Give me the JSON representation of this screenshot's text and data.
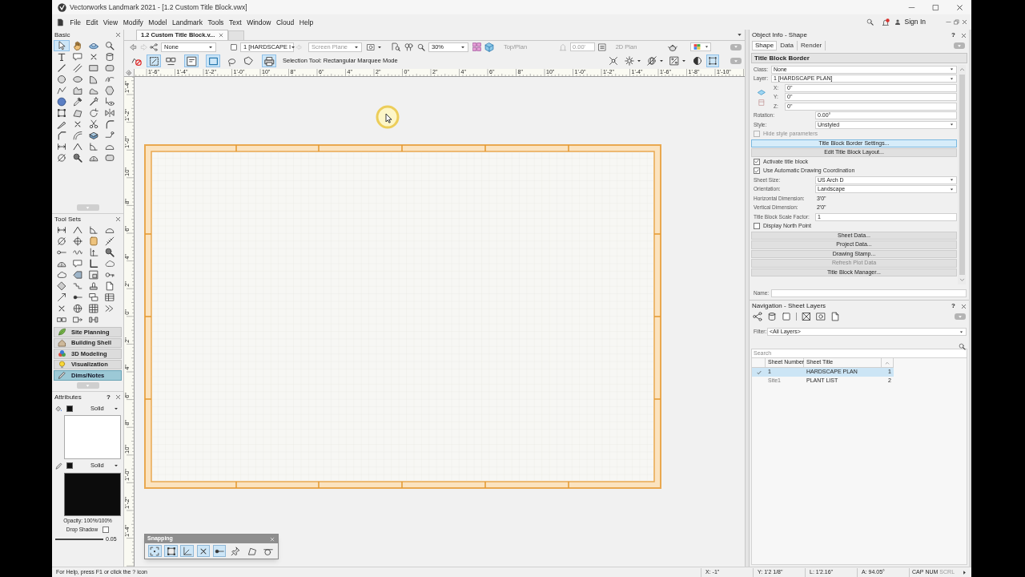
{
  "window": {
    "title": "Vectorworks Landmark 2021 - [1.2 Custom Title Block.vwx]"
  },
  "menu_bar": {
    "items": [
      "File",
      "Edit",
      "View",
      "Modify",
      "Model",
      "Landmark",
      "Tools",
      "Text",
      "Window",
      "Cloud",
      "Help"
    ],
    "sign_in": "Sign In"
  },
  "basic_palette": {
    "title": "Basic",
    "tools": [
      {
        "selected": true
      },
      {
        "selected": false
      },
      {
        "selected": false
      },
      {
        "selected": false
      },
      {
        "selected": false
      },
      {
        "selected": false
      },
      {
        "selected": false
      },
      {
        "selected": false
      },
      {
        "selected": false
      },
      {
        "selected": false
      },
      {
        "selected": false
      },
      {
        "selected": false
      },
      {
        "selected": false
      },
      {
        "selected": false
      },
      {
        "selected": false
      },
      {
        "selected": false
      },
      {
        "selected": false
      },
      {
        "selected": false
      },
      {
        "selected": false
      },
      {
        "selected": false
      },
      {
        "selected": false
      },
      {
        "selected": false
      },
      {
        "selected": false
      },
      {
        "selected": false
      },
      {
        "selected": false
      },
      {
        "selected": false
      },
      {
        "selected": false
      },
      {
        "selected": false
      },
      {
        "selected": false
      },
      {
        "selected": false
      },
      {
        "selected": false
      },
      {
        "selected": false
      },
      {
        "selected": false
      },
      {
        "selected": false
      },
      {
        "selected": false
      },
      {
        "selected": false
      },
      {
        "selected": false
      },
      {
        "selected": false
      },
      {
        "selected": false
      },
      {
        "selected": false
      },
      {
        "selected": false
      },
      {
        "selected": false
      },
      {
        "selected": false
      },
      {
        "selected": false
      }
    ]
  },
  "tool_sets_palette": {
    "title": "Tool Sets",
    "tool_sets": [
      {
        "label": "Site Planning",
        "selected": false
      },
      {
        "label": "Building Shell",
        "selected": false
      },
      {
        "label": "3D Modeling",
        "selected": false
      },
      {
        "label": "Visualization",
        "selected": false
      },
      {
        "label": "Dims/Notes",
        "selected": true
      }
    ]
  },
  "attributes": {
    "title": "Attributes",
    "help": "?",
    "fill_style": "Solid",
    "pen_style": "Solid",
    "opacity": "Opacity: 100%/100%",
    "drop_shadow": {
      "label": "Drop Shadow",
      "checked": false
    },
    "line_thickness": "0.05"
  },
  "document_tabs": [
    {
      "label": "1.2 Custom Title Block.v...",
      "selected": true
    },
    {
      "selected": false
    }
  ],
  "view_bar": {
    "class": "None",
    "layer": "1 [HARDSCAPE I",
    "plane": {
      "value": "Screen Plane",
      "disabled": true
    },
    "zoom": "30%",
    "view": {
      "value": "Top/Plan",
      "disabled": true
    },
    "elevation": {
      "value": "0.00'",
      "disabled": true
    },
    "render_mode": {
      "value": "2D Plan",
      "disabled": true
    }
  },
  "mode_bar": {
    "modes": [
      {
        "selected": false
      },
      {
        "selected": true
      },
      {
        "selected": false
      },
      {
        "selected": true
      },
      {
        "selected": true
      },
      {
        "selected": false
      },
      {
        "selected": false
      },
      {
        "selected": true
      }
    ],
    "hint": "Selection Tool: Rectangular Marquee Mode",
    "options": [
      {
        "on": false
      },
      {
        "on": false
      },
      {
        "on": false
      },
      {
        "on": false
      },
      {
        "on": false
      },
      {
        "on": true
      }
    ]
  },
  "rulers": {
    "horizontal": [
      "1'-6\"",
      "1'-4\"",
      "1'-2\"",
      "1'-0\"",
      "10\"",
      "8\"",
      "6\"",
      "4\"",
      "2\"",
      "0\"",
      "2\"",
      "4\"",
      "6\"",
      "8\"",
      "10\"",
      "1'-0\"",
      "1'-2\"",
      "1'-4\"",
      "1'-6\"",
      "1'-8\"",
      "1'-10\""
    ],
    "vertical": [
      "1'-4\"",
      "1'-2\"",
      "1'-0\"",
      "10\"",
      "8\"",
      "6\"",
      "4\"",
      "2\"",
      "0\"",
      "2\"",
      "4\"",
      "6\"",
      "8\"",
      "10\"",
      "1'-0\"",
      "1'-2\"",
      "1'-4\""
    ]
  },
  "snapping": {
    "title": "Snapping",
    "buttons": [
      {
        "on": true
      },
      {
        "on": true
      },
      {
        "on": true
      },
      {
        "on": true
      },
      {
        "on": true
      },
      {
        "on": false
      },
      {
        "on": false
      },
      {
        "on": false
      }
    ]
  },
  "object_info": {
    "title": "Object Info - Shape",
    "help": "?",
    "tabs": [
      {
        "label": "Shape",
        "selected": true
      },
      {
        "label": "Data",
        "selected": false
      },
      {
        "label": "Render",
        "selected": false
      }
    ],
    "heading": "Title Block Border",
    "class_layer": [
      {
        "label": "Class:",
        "value": "None"
      },
      {
        "label": "Layer:",
        "value": "1 [HARDSCAPE PLAN]"
      }
    ],
    "coordinates": [
      {
        "label": "X:",
        "value": "0\""
      },
      {
        "label": "Y:",
        "value": "0\""
      },
      {
        "label": "Z:",
        "value": "0\""
      }
    ],
    "parameters": [
      {
        "kind": "field",
        "label": "Rotation:",
        "value": "0.00°"
      },
      {
        "kind": "dropdown",
        "label": "Style:",
        "value": "Unstyled"
      },
      {
        "kind": "checkbox",
        "label": "Hide style parameters",
        "checked": false,
        "disabled": true
      },
      {
        "kind": "button",
        "label": "Title Block Border Settings...",
        "highlighted": true,
        "disabled": false
      },
      {
        "kind": "button",
        "label": "Edit Title Block Layout...",
        "highlighted": false,
        "disabled": false
      },
      {
        "kind": "checkbox",
        "label": "Activate title block",
        "checked": true,
        "disabled": false
      },
      {
        "kind": "checkbox",
        "label": "Use Automatic Drawing Coordination",
        "checked": true,
        "disabled": false
      },
      {
        "kind": "dropdown",
        "label": "Sheet Size:",
        "value": "US Arch D"
      },
      {
        "kind": "dropdown",
        "label": "Orientation:",
        "value": "Landscape"
      },
      {
        "kind": "text",
        "label": "Horizontal Dimension:",
        "value": "3'0\""
      },
      {
        "kind": "text",
        "label": "Vertical Dimension:",
        "value": "2'0\""
      },
      {
        "kind": "field",
        "label": "Title Block Scale Factor:",
        "value": "1"
      },
      {
        "kind": "checkbox",
        "label": "Display North Point",
        "checked": false,
        "disabled": false
      },
      {
        "kind": "button",
        "label": "Sheet Data...",
        "highlighted": false,
        "disabled": false
      },
      {
        "kind": "button",
        "label": "Project Data...",
        "highlighted": false,
        "disabled": false
      },
      {
        "kind": "button",
        "label": "Drawing Stamp...",
        "highlighted": false,
        "disabled": false
      },
      {
        "kind": "button",
        "label": "Refresh Plot Data",
        "highlighted": false,
        "disabled": true
      },
      {
        "kind": "button",
        "label": "Title Block Manager...",
        "highlighted": false,
        "disabled": false
      }
    ],
    "name_field": {
      "label": "Name:"
    }
  },
  "navigation": {
    "title": "Navigation - Sheet Layers",
    "help": "?",
    "filter": {
      "label": "Filter:",
      "value": "<All Layers>"
    },
    "search": {
      "placeholder": "Search"
    },
    "columns": [
      "Sheet Number",
      "Sheet Title"
    ],
    "rows": [
      {
        "checked": true,
        "sheet_number": "1",
        "sheet_title": "HARDSCAPE PLAN",
        "column_4": "1",
        "selected": true
      },
      {
        "checked": false,
        "sheet_number": "Site1",
        "sheet_title": "PLANT LIST",
        "column_4": "2",
        "selected": false
      }
    ]
  },
  "status_bar": {
    "help": "For Help, press F1 or click the ? icon",
    "fields": [
      "X: -1\"",
      "Y: 1'2 1/8\"",
      "L: 1'2.16\"",
      "A: 94.05°"
    ],
    "keys": [
      {
        "label": "CAP",
        "on": true
      },
      {
        "label": "NUM",
        "on": true
      },
      {
        "label": "SCRL",
        "on": false
      }
    ]
  }
}
